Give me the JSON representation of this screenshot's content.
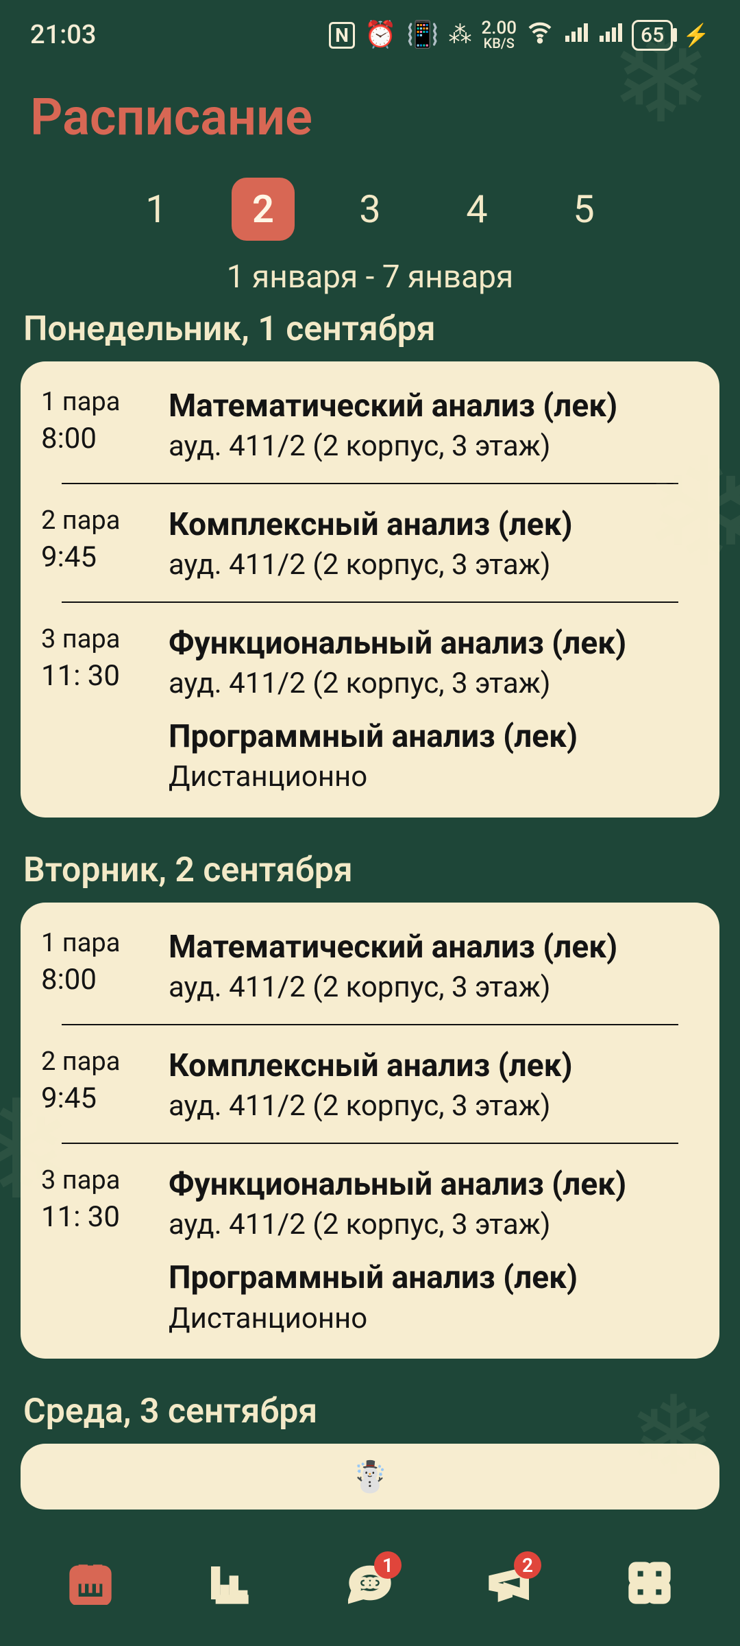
{
  "status": {
    "time": "21:03",
    "nfc": "N",
    "kbs_top": "2.00",
    "kbs_bot": "KB/S",
    "battery": "65"
  },
  "header": {
    "title": "Расписание"
  },
  "weeks": {
    "items": [
      "1",
      "2",
      "3",
      "4",
      "5"
    ],
    "active_index": 1
  },
  "date_range": "1 января - 7 января",
  "days": [
    {
      "label": "Понедельник, 1 сентября",
      "rows": [
        {
          "para": "1 пара",
          "time": "8:00",
          "courses": [
            {
              "title": "Математический анализ (лек)",
              "loc": "ауд. 411/2 (2 корпус, 3 этаж)"
            }
          ]
        },
        {
          "para": "2 пара",
          "time": "9:45",
          "courses": [
            {
              "title": "Комплексный анализ (лек)",
              "loc": "ауд. 411/2 (2 корпус, 3 этаж)"
            }
          ]
        },
        {
          "para": "3 пара",
          "time": "11: 30",
          "courses": [
            {
              "title": "Функциональный анализ (лек)",
              "loc": "ауд. 411/2 (2 корпус, 3 этаж)"
            },
            {
              "title": "Программный анализ (лек)",
              "loc": "Дистанционно"
            }
          ]
        }
      ]
    },
    {
      "label": "Вторник, 2 сентября",
      "rows": [
        {
          "para": "1 пара",
          "time": "8:00",
          "courses": [
            {
              "title": "Математический анализ (лек)",
              "loc": "ауд. 411/2 (2 корпус, 3 этаж)"
            }
          ]
        },
        {
          "para": "2 пара",
          "time": "9:45",
          "courses": [
            {
              "title": "Комплексный анализ (лек)",
              "loc": "ауд. 411/2 (2 корпус, 3 этаж)"
            }
          ]
        },
        {
          "para": "3 пара",
          "time": "11: 30",
          "courses": [
            {
              "title": "Функциональный анализ (лек)",
              "loc": "ауд. 411/2 (2 корпус, 3 этаж)"
            },
            {
              "title": "Программный анализ (лек)",
              "loc": "Дистанционно"
            }
          ]
        }
      ]
    },
    {
      "label": "Среда, 3 сентября",
      "empty": true,
      "empty_icon": "☃️"
    }
  ],
  "nav": {
    "badges": {
      "chat": "1",
      "announce": "2"
    }
  }
}
